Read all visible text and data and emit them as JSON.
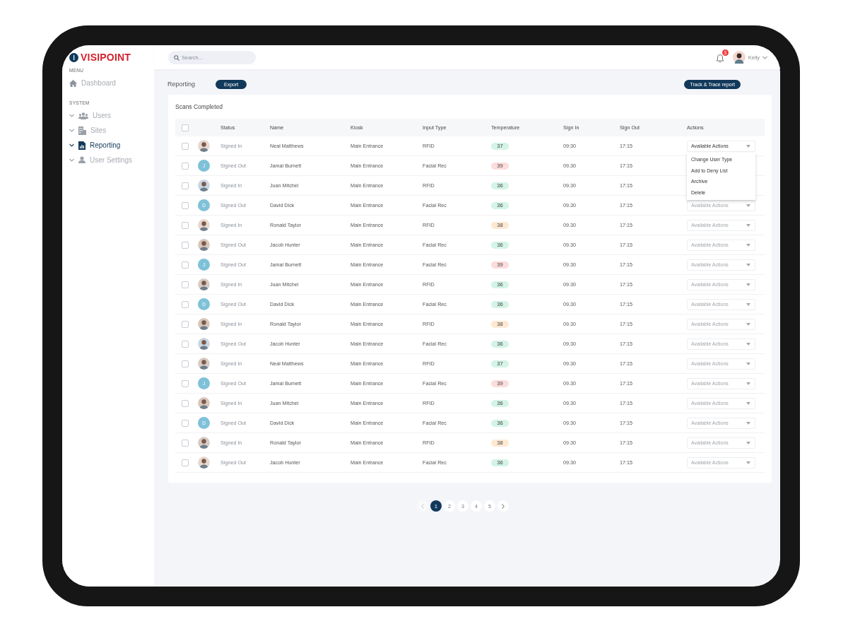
{
  "brand": {
    "name": "VISIPOINT"
  },
  "search": {
    "placeholder": "Search..."
  },
  "notifications": {
    "count": "3"
  },
  "user": {
    "name": "Kelly"
  },
  "sidebar": {
    "sections": [
      {
        "heading": "MENU",
        "items": [
          {
            "label": "Dashboard",
            "expandable": false,
            "selected": false
          }
        ]
      },
      {
        "heading": "SYSTEM",
        "items": [
          {
            "label": "Users",
            "expandable": true,
            "selected": false
          },
          {
            "label": "Sites",
            "expandable": true,
            "selected": false
          },
          {
            "label": "Reporting",
            "expandable": true,
            "selected": true
          },
          {
            "label": "User Settings",
            "expandable": true,
            "selected": false
          }
        ]
      }
    ]
  },
  "page": {
    "title": "Reporting",
    "export_button": "Export",
    "track_button": "Track & Trace report"
  },
  "table": {
    "title": "Scans Completed",
    "header_checked": false,
    "columns": [
      "Status",
      "Name",
      "Kiosk",
      "Input Type",
      "Temperature",
      "Sign In",
      "Sign Out",
      "Actions"
    ],
    "rows": [
      {
        "checked": false,
        "avatar": {
          "kind": "photo"
        },
        "status": "Signed In",
        "name": "Neal Matthews",
        "kiosk": "Main Entrance",
        "input_type": "RFID",
        "temperature": {
          "value": "37",
          "color": "#d3f4e6"
        },
        "sign_in": "09:30",
        "sign_out": "17:15",
        "actions": {
          "label": "Available Actions",
          "expanded": true,
          "menu": [
            "Change User Type",
            "Add to Deny List",
            "Archive",
            "Delete"
          ]
        }
      },
      {
        "checked": false,
        "avatar": {
          "kind": "initial",
          "letter": "J"
        },
        "status": "Signed Out",
        "name": "Jamal Burnett",
        "kiosk": "Main Entrance",
        "input_type": "Facial Rec",
        "temperature": {
          "value": "39",
          "color": "#fcdcdc"
        },
        "sign_in": "09.30",
        "sign_out": "17:15"
      },
      {
        "checked": false,
        "avatar": {
          "kind": "photo"
        },
        "status": "Signed In",
        "name": "Juan Mitchel",
        "kiosk": "Main Entrance",
        "input_type": "RFID",
        "temperature": {
          "value": "36",
          "color": "#d3f4e6"
        },
        "sign_in": "09.30",
        "sign_out": "17:15"
      },
      {
        "checked": false,
        "avatar": {
          "kind": "initial",
          "letter": "D"
        },
        "status": "Signed Out",
        "name": "David Dick",
        "kiosk": "Main Entrance",
        "input_type": "Facial Rec",
        "temperature": {
          "value": "36",
          "color": "#d3f4e6"
        },
        "sign_in": "09.30",
        "sign_out": "17:15",
        "actions": {
          "label": "Available Actions",
          "expanded": false
        }
      },
      {
        "checked": false,
        "avatar": {
          "kind": "photo"
        },
        "status": "Signed In",
        "name": "Ronald Taylor",
        "kiosk": "Main Entrance",
        "input_type": "RFID",
        "temperature": {
          "value": "38",
          "color": "#fde9d2"
        },
        "sign_in": "09.30",
        "sign_out": "17:15",
        "actions": {
          "label": "Available Actions",
          "expanded": false
        }
      },
      {
        "checked": false,
        "avatar": {
          "kind": "photo"
        },
        "status": "Signed Out",
        "name": "Jacob Hunter",
        "kiosk": "Main Entrance",
        "input_type": "Facial Rec",
        "temperature": {
          "value": "36",
          "color": "#d3f4e6"
        },
        "sign_in": "09.30",
        "sign_out": "17:15",
        "actions": {
          "label": "Available Actions",
          "expanded": false
        }
      },
      {
        "checked": false,
        "avatar": {
          "kind": "initial",
          "letter": "J"
        },
        "status": "Signed Out",
        "name": "Jamal Burnett",
        "kiosk": "Main Entrance",
        "input_type": "Facial Rec",
        "temperature": {
          "value": "39",
          "color": "#fcdcdc"
        },
        "sign_in": "09.30",
        "sign_out": "17:15",
        "actions": {
          "label": "Available Actions",
          "expanded": false
        }
      },
      {
        "checked": false,
        "avatar": {
          "kind": "photo"
        },
        "status": "Signed In",
        "name": "Juan Mitchel",
        "kiosk": "Main Entrance",
        "input_type": "RFID",
        "temperature": {
          "value": "36",
          "color": "#d3f4e6"
        },
        "sign_in": "09.30",
        "sign_out": "17:15",
        "actions": {
          "label": "Available Actions",
          "expanded": false
        }
      },
      {
        "checked": false,
        "avatar": {
          "kind": "initial",
          "letter": "D"
        },
        "status": "Signed Out",
        "name": "David Dick",
        "kiosk": "Main Entrance",
        "input_type": "Facial Rec",
        "temperature": {
          "value": "36",
          "color": "#d3f4e6"
        },
        "sign_in": "09.30",
        "sign_out": "17:15",
        "actions": {
          "label": "Available Actions",
          "expanded": false
        }
      },
      {
        "checked": false,
        "avatar": {
          "kind": "photo"
        },
        "status": "Signed In",
        "name": "Ronald Taylor",
        "kiosk": "Main Entrance",
        "input_type": "RFID",
        "temperature": {
          "value": "38",
          "color": "#fde9d2"
        },
        "sign_in": "09.30",
        "sign_out": "17:15",
        "actions": {
          "label": "Available Actions",
          "expanded": false
        }
      },
      {
        "checked": false,
        "avatar": {
          "kind": "photo"
        },
        "status": "Signed Out",
        "name": "Jacob Hunter",
        "kiosk": "Main Entrance",
        "input_type": "Facial Rec",
        "temperature": {
          "value": "36",
          "color": "#d3f4e6"
        },
        "sign_in": "09.30",
        "sign_out": "17:15",
        "actions": {
          "label": "Available Actions",
          "expanded": false
        }
      },
      {
        "checked": false,
        "avatar": {
          "kind": "photo"
        },
        "status": "Signed In",
        "name": "Neal Matthews",
        "kiosk": "Main Entrance",
        "input_type": "RFID",
        "temperature": {
          "value": "37",
          "color": "#d3f4e6"
        },
        "sign_in": "09.30",
        "sign_out": "17:15",
        "actions": {
          "label": "Available Actions",
          "expanded": false
        }
      },
      {
        "checked": false,
        "avatar": {
          "kind": "initial",
          "letter": "J"
        },
        "status": "Signed Out",
        "name": "Jamal Burnett",
        "kiosk": "Main Entrance",
        "input_type": "Facial Rec",
        "temperature": {
          "value": "39",
          "color": "#fcdcdc"
        },
        "sign_in": "09.30",
        "sign_out": "17:15",
        "actions": {
          "label": "Available Actions",
          "expanded": false
        }
      },
      {
        "checked": false,
        "avatar": {
          "kind": "photo"
        },
        "status": "Signed In",
        "name": "Juan Mitchel",
        "kiosk": "Main Entrance",
        "input_type": "RFID",
        "temperature": {
          "value": "36",
          "color": "#d3f4e6"
        },
        "sign_in": "09.30",
        "sign_out": "17:15",
        "actions": {
          "label": "Available Actions",
          "expanded": false
        }
      },
      {
        "checked": false,
        "avatar": {
          "kind": "initial",
          "letter": "D"
        },
        "status": "Signed Out",
        "name": "David Dick",
        "kiosk": "Main Entrance",
        "input_type": "Facial Rec",
        "temperature": {
          "value": "36",
          "color": "#d3f4e6"
        },
        "sign_in": "09.30",
        "sign_out": "17:15",
        "actions": {
          "label": "Available Actions",
          "expanded": false
        }
      },
      {
        "checked": false,
        "avatar": {
          "kind": "photo"
        },
        "status": "Signed In",
        "name": "Ronald Taylor",
        "kiosk": "Main Entrance",
        "input_type": "RFID",
        "temperature": {
          "value": "38",
          "color": "#fde9d2"
        },
        "sign_in": "09.30",
        "sign_out": "17:15",
        "actions": {
          "label": "Available Actions",
          "expanded": false
        }
      },
      {
        "checked": false,
        "avatar": {
          "kind": "photo"
        },
        "status": "Signed Out",
        "name": "Jacob Hunter",
        "kiosk": "Main Entrance",
        "input_type": "Facial Rec",
        "temperature": {
          "value": "36",
          "color": "#d3f4e6"
        },
        "sign_in": "09.30",
        "sign_out": "17:15",
        "actions": {
          "label": "Available Actions",
          "expanded": false
        }
      }
    ]
  },
  "pagination": {
    "prev_disabled": true,
    "pages": [
      {
        "label": "1",
        "selected": true
      },
      {
        "label": "2",
        "selected": false
      },
      {
        "label": "3",
        "selected": false
      },
      {
        "label": "4",
        "selected": false
      },
      {
        "label": "5",
        "selected": false
      }
    ]
  }
}
